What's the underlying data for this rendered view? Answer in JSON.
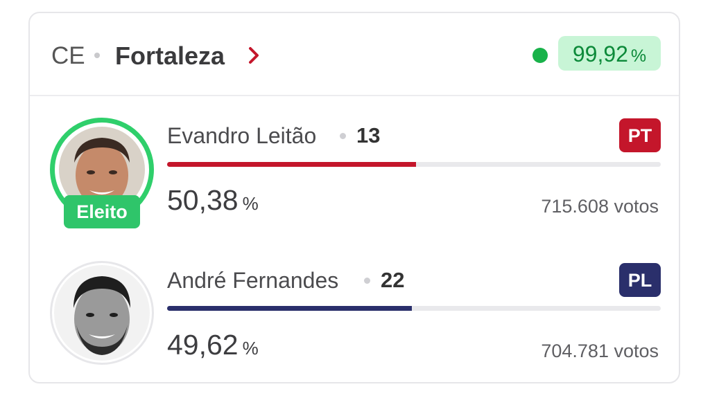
{
  "header": {
    "state": "CE",
    "city": "Fortaleza",
    "apuracao": {
      "value": "99,92",
      "unit": "%"
    },
    "colors": {
      "status_dot": "#19b24a",
      "badge_bg": "#c8f5d6",
      "badge_text": "#0d8a3a",
      "chevron": "#c4162b"
    },
    "icons": {
      "chevron": "chevron-right-icon",
      "status": "live-status-dot"
    }
  },
  "candidates": [
    {
      "name": "Evandro Leitão",
      "number": "13",
      "party": "PT",
      "party_color": "#c4162b",
      "percent": "50,38",
      "percent_unit": "%",
      "bar_fraction": 0.5038,
      "bar_color": "#c4162b",
      "votes": "715.608 votos",
      "elected_label": "Eleito"
    },
    {
      "name": "André Fernandes",
      "number": "22",
      "party": "PL",
      "party_color": "#2a2f6b",
      "percent": "49,62",
      "percent_unit": "%",
      "bar_fraction": 0.4962,
      "bar_color": "#2a2f6b",
      "votes": "704.781 votos"
    }
  ]
}
